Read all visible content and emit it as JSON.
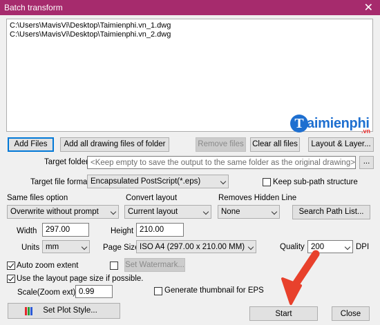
{
  "window": {
    "title": "Batch transform",
    "close_glyph": "✕"
  },
  "files": [
    "C:\\Users\\MavisVi\\Desktop\\Taimienphi.vn_1.dwg",
    "C:\\Users\\MavisVi\\Desktop\\Taimienphi.vn_2.dwg"
  ],
  "watermark": {
    "brand": "aimienphi",
    "initial": "T",
    "tld": ".vn"
  },
  "buttons": {
    "add_files": "Add Files",
    "add_folder": "Add all drawing files of folder",
    "remove_files": "Remove files",
    "clear_all": "Clear all files",
    "layout_layer": "Layout & Layer...",
    "browse": "...",
    "search_path": "Search Path List...",
    "set_watermark": "Set Watermark...",
    "set_plot_style": "Set Plot Style...",
    "start": "Start",
    "close": "Close"
  },
  "target_folder": {
    "label": "Target folder",
    "placeholder": "<Keep empty to save the output to the same folder as the original drawing>"
  },
  "target_format": {
    "label": "Target file format",
    "value": "Encapsulated PostScript(*.eps)",
    "keep_subpath_label": "Keep sub-path structure",
    "keep_subpath_checked": false
  },
  "same_files": {
    "label": "Same files option",
    "value": "Overwrite without prompt"
  },
  "convert_layout": {
    "label": "Convert layout",
    "value": "Current layout"
  },
  "hidden_line": {
    "label": "Removes Hidden Line",
    "value": "None"
  },
  "width": {
    "label": "Width",
    "value": "297.00"
  },
  "height": {
    "label": "Height",
    "value": "210.00"
  },
  "units": {
    "label": "Units",
    "value": "mm"
  },
  "page_size": {
    "label": "Page Size",
    "value": "ISO A4 (297.00 x 210.00 MM)"
  },
  "quality": {
    "label": "Quality",
    "value": "200",
    "unit": "DPI"
  },
  "auto_zoom": {
    "label": "Auto zoom extent",
    "checked": true
  },
  "watermark_check": {
    "checked": false
  },
  "layout_page_size": {
    "label": "Use the layout page size if possible.",
    "checked": true
  },
  "scale": {
    "label": "Scale(Zoom ext)",
    "value": "0.99"
  },
  "thumbnail": {
    "label": "Generate thumbnail for EPS",
    "checked": false
  },
  "colors": {
    "titlebar": "#a62b6d",
    "accent": "#0078d7",
    "arrow": "#e8412c",
    "brand": "#1e6fd0"
  }
}
